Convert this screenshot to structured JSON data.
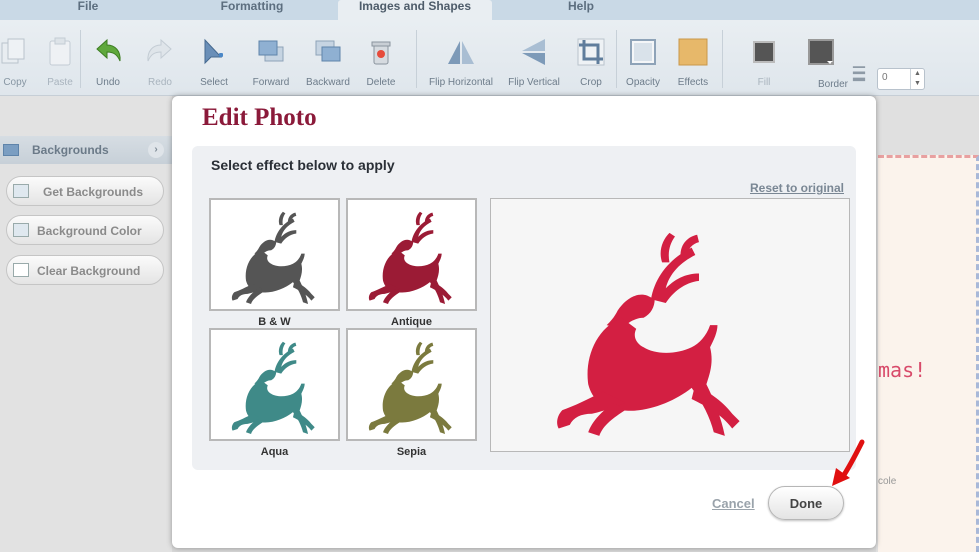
{
  "menu": {
    "tabs": [
      {
        "label": "File"
      },
      {
        "label": "Formatting"
      },
      {
        "label": "Images and Shapes"
      },
      {
        "label": "Help"
      }
    ],
    "active_index": 2
  },
  "toolbar": {
    "copy": "Copy",
    "paste": "Paste",
    "undo": "Undo",
    "redo": "Redo",
    "select": "Select",
    "forward": "Forward",
    "backward": "Backward",
    "delete": "Delete",
    "flip_horizontal": "Flip Horizontal",
    "flip_vertical": "Flip Vertical",
    "crop": "Crop",
    "opacity": "Opacity",
    "effects": "Effects",
    "fill": "Fill",
    "border": "Border",
    "border_width_value": "0"
  },
  "left_panel": {
    "header": "Backgrounds",
    "buttons": [
      {
        "label": "Get Backgrounds"
      },
      {
        "label": "Background Color"
      },
      {
        "label": "Clear Background"
      }
    ]
  },
  "canvas": {
    "card_text": "mas!",
    "card_small_text": "cole"
  },
  "modal": {
    "title": "Edit Photo",
    "instruction": "Select effect below to apply",
    "reset_label": "Reset to original",
    "effects": [
      {
        "label": "B & W",
        "color": "#555555"
      },
      {
        "label": "Antique",
        "color": "#9b1b35"
      },
      {
        "label": "Aqua",
        "color": "#3f8a88"
      },
      {
        "label": "Sepia",
        "color": "#7b7a3e"
      }
    ],
    "preview_color": "#d31f42",
    "cancel_label": "Cancel",
    "done_label": "Done"
  },
  "colors": {
    "title_color": "#8b1a3a",
    "annotation_arrow": "#e01010"
  }
}
